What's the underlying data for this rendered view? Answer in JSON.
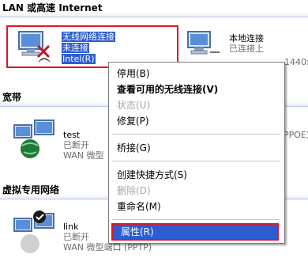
{
  "sections": {
    "lan": "LAN 或高速 Internet",
    "broadband": "宽带",
    "vpn": "虚拟专用网络"
  },
  "wireless": {
    "name": "无线网络连接",
    "status": "未连接",
    "device": "Intel(R)"
  },
  "local": {
    "name": "本地连接",
    "status": "已连接上",
    "partial": "1440x"
  },
  "test": {
    "name": "test",
    "status": "已断开",
    "type": "WAN 微型",
    "partial": "PPOE)"
  },
  "link": {
    "name": "link",
    "status": "已断开",
    "type": "WAN 微型端口 (PPTP)"
  },
  "menu": {
    "items": [
      {
        "label": "停用(B)"
      },
      {
        "label": "查看可用的无线连接(V)"
      },
      {
        "label": "状态(U)"
      },
      {
        "label": "修复(P)"
      },
      {
        "label": "桥接(G)"
      },
      {
        "label": "创建快捷方式(S)"
      },
      {
        "label": "删除(D)"
      },
      {
        "label": "重命名(M)"
      },
      {
        "label": "属性(R)"
      }
    ]
  },
  "colors": {
    "selection": "#2c5dd0",
    "annotation_red": "#e0142a"
  }
}
